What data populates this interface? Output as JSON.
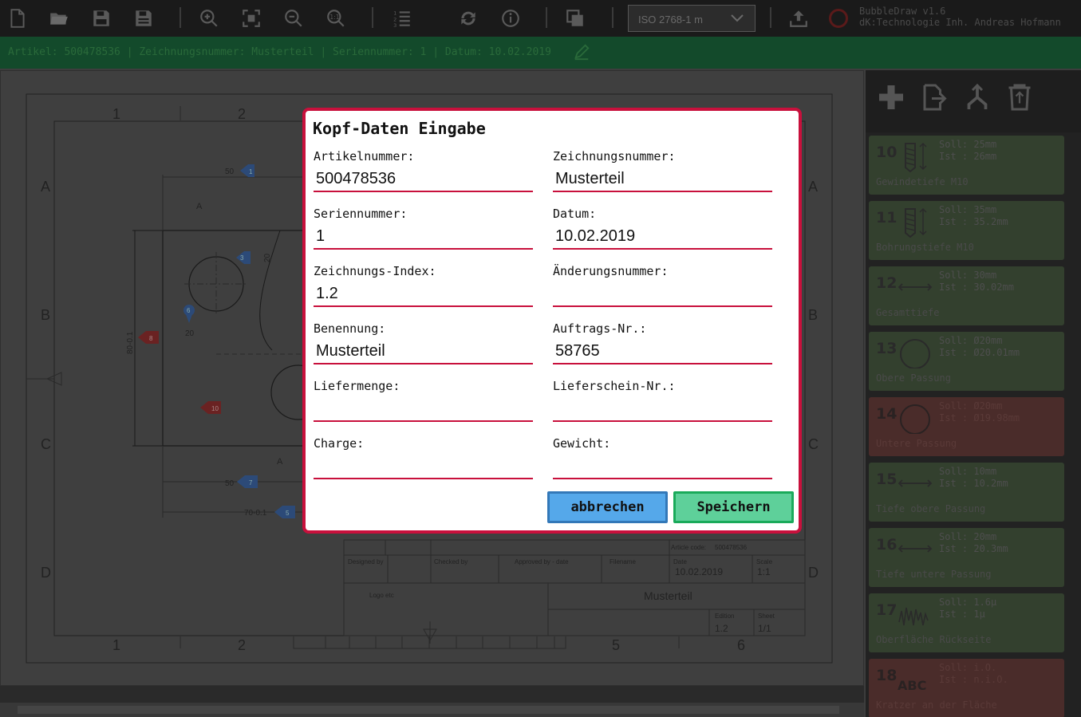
{
  "toolbar": {
    "icons": [
      "new-file-icon",
      "open-folder-icon",
      "save-icon",
      "save-as-icon",
      "zoom-in-icon",
      "zoom-fit-icon",
      "zoom-out-icon",
      "zoom-reset-icon",
      "numbered-list-icon",
      "refresh-icon",
      "info-icon",
      "copy-icon",
      "upload-icon"
    ],
    "standard_select": "ISO 2768-1 m",
    "brand_line1": "BubbleDraw v1.6",
    "brand_line2": "dK:Technologie Inh. Andreas Hofmann"
  },
  "infobar": {
    "text": "Artikel: 500478536 | Zeichnungsnummer: Musterteil | Seriennummer: 1 | Datum: 10.02.2019"
  },
  "drawing": {
    "col_labels": [
      "1",
      "2",
      "5",
      "6"
    ],
    "row_labels": [
      "A",
      "B",
      "C",
      "D"
    ],
    "section_label": "A",
    "dims": [
      "50",
      "20",
      "80-0.1",
      "20",
      "50",
      "70-0.1"
    ],
    "bubbles": [
      "1",
      "3",
      "6",
      "8",
      "7",
      "5",
      "10"
    ],
    "title_block": {
      "article_code_label": "Article code:",
      "article_code": "500478536",
      "designed_by": "Designed by",
      "checked_by": "Checked by",
      "approved_by": "Approved by - date",
      "filename": "Filename",
      "date_label": "Date",
      "date": "10.02.2019",
      "scale_label": "Scale",
      "scale": "1:1",
      "logo": "Logo etc",
      "title": "Musterteil",
      "edition_label": "Edition",
      "edition": "1.2",
      "sheet_label": "Sheet",
      "sheet": "1/1"
    }
  },
  "sidebar": {
    "tools": [
      "add-icon",
      "export-icon",
      "split-icon",
      "delete-icon"
    ],
    "items": [
      {
        "num": "10",
        "soll": "Soll: 25mm",
        "ist": "Ist : 26mm",
        "desc": "Gewindetiefe M10",
        "status": "ok",
        "symbol": "thread-icon"
      },
      {
        "num": "11",
        "soll": "Soll: 35mm",
        "ist": "Ist : 35.2mm",
        "desc": "Bohrungstiefe M10",
        "status": "ok",
        "symbol": "thread-icon"
      },
      {
        "num": "12",
        "soll": "Soll: 30mm",
        "ist": "Ist : 30.02mm",
        "desc": "Gesamttiefe",
        "status": "ok",
        "symbol": "length-icon"
      },
      {
        "num": "13",
        "soll": "Soll: Ø20mm",
        "ist": "Ist : Ø20.01mm",
        "desc": "Obere Passung",
        "status": "ok",
        "symbol": "diameter-icon"
      },
      {
        "num": "14",
        "soll": "Soll: Ø20mm",
        "ist": "Ist : Ø19.98mm",
        "desc": "Untere Passung",
        "status": "bad",
        "symbol": "diameter-icon"
      },
      {
        "num": "15",
        "soll": "Soll: 10mm",
        "ist": "Ist : 10.2mm",
        "desc": "Tiefe obere Passung",
        "status": "ok",
        "symbol": "length-icon"
      },
      {
        "num": "16",
        "soll": "Soll: 20mm",
        "ist": "Ist : 20.3mm",
        "desc": "Tiefe untere Passung",
        "status": "ok",
        "symbol": "length-icon"
      },
      {
        "num": "17",
        "soll": "Soll: 1.6µ",
        "ist": "Ist : 1µ",
        "desc": "Oberfläche Rückseite",
        "status": "ok",
        "symbol": "roughness-icon"
      },
      {
        "num": "18",
        "soll": "Soll: i.O.",
        "ist": "Ist : n.i.O.",
        "desc": "Kratzer an der Fläche",
        "status": "bad",
        "symbol": "text-icon",
        "symbol_text": "ABC"
      }
    ]
  },
  "modal": {
    "title": "Kopf-Daten Eingabe",
    "fields": {
      "artikelnummer": {
        "label": "Artikelnummer:",
        "value": "500478536"
      },
      "zeichnungsnummer": {
        "label": "Zeichnungsnummer:",
        "value": "Musterteil"
      },
      "seriennummer": {
        "label": "Seriennummer:",
        "value": "1"
      },
      "datum": {
        "label": "Datum:",
        "value": "10.02.2019"
      },
      "zeichnungs_index": {
        "label": "Zeichnungs-Index:",
        "value": "1.2"
      },
      "aenderungsnummer": {
        "label": "Änderungsnummer:",
        "value": ""
      },
      "benennung": {
        "label": "Benennung:",
        "value": "Musterteil"
      },
      "auftrags_nr": {
        "label": "Auftrags-Nr.:",
        "value": "58765"
      },
      "liefermenge": {
        "label": "Liefermenge:",
        "value": ""
      },
      "lieferschein_nr": {
        "label": "Lieferschein-Nr.:",
        "value": ""
      },
      "charge": {
        "label": "Charge:",
        "value": ""
      },
      "gewicht": {
        "label": "Gewicht:",
        "value": ""
      }
    },
    "cancel_label": "abbrechen",
    "save_label": "Speichern"
  },
  "colors": {
    "modal_border": "#c8103c",
    "cancel_bg": "#55a8ea",
    "save_bg": "#5ed09a",
    "item_ok": "#33402e",
    "item_bad": "#4a2c2a",
    "infobar": "#134a2b"
  }
}
